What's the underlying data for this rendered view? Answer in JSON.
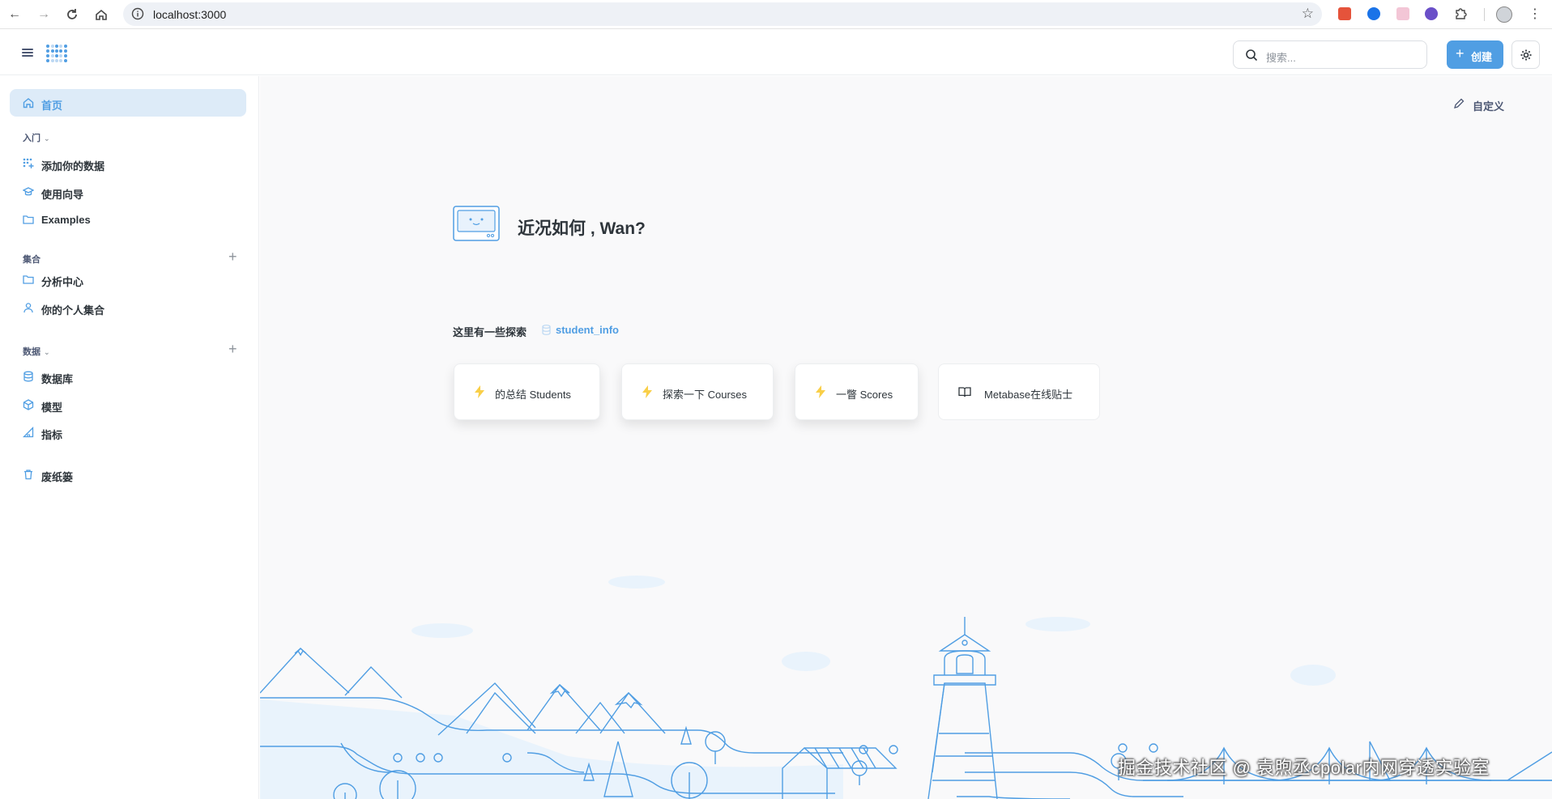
{
  "browser": {
    "url": "localhost:3000"
  },
  "header": {
    "search_placeholder": "搜索...",
    "create_label": "创建"
  },
  "sidebar": {
    "home_label": "首页",
    "getting_started": {
      "heading": "入门",
      "items": [
        "添加你的数据",
        "使用向导",
        "Examples"
      ]
    },
    "collections": {
      "heading": "集合",
      "items": [
        "分析中心",
        "你的个人集合"
      ]
    },
    "data": {
      "heading": "数据",
      "items": [
        "数据库",
        "模型",
        "指标"
      ]
    },
    "trash_label": "废纸篓"
  },
  "main": {
    "customize_label": "自定义",
    "greeting": "近况如何 , Wan?",
    "explore_label": "这里有一些探索",
    "explore_db": "student_info",
    "cards": [
      {
        "label": "的总结 Students",
        "icon": "lightning-icon"
      },
      {
        "label": "探索一下 Courses",
        "icon": "lightning-icon"
      },
      {
        "label": "一瞥 Scores",
        "icon": "lightning-icon"
      },
      {
        "label": "Metabase在线贴士",
        "icon": "book-icon"
      }
    ]
  },
  "watermark": "掘金技术社区 @ 袁煦丞cpolar内网穿透实验室",
  "colors": {
    "brand": "#509ee3",
    "active_bg": "#ddebf8",
    "main_bg": "#f9f9fa",
    "text": "#2e353b"
  }
}
